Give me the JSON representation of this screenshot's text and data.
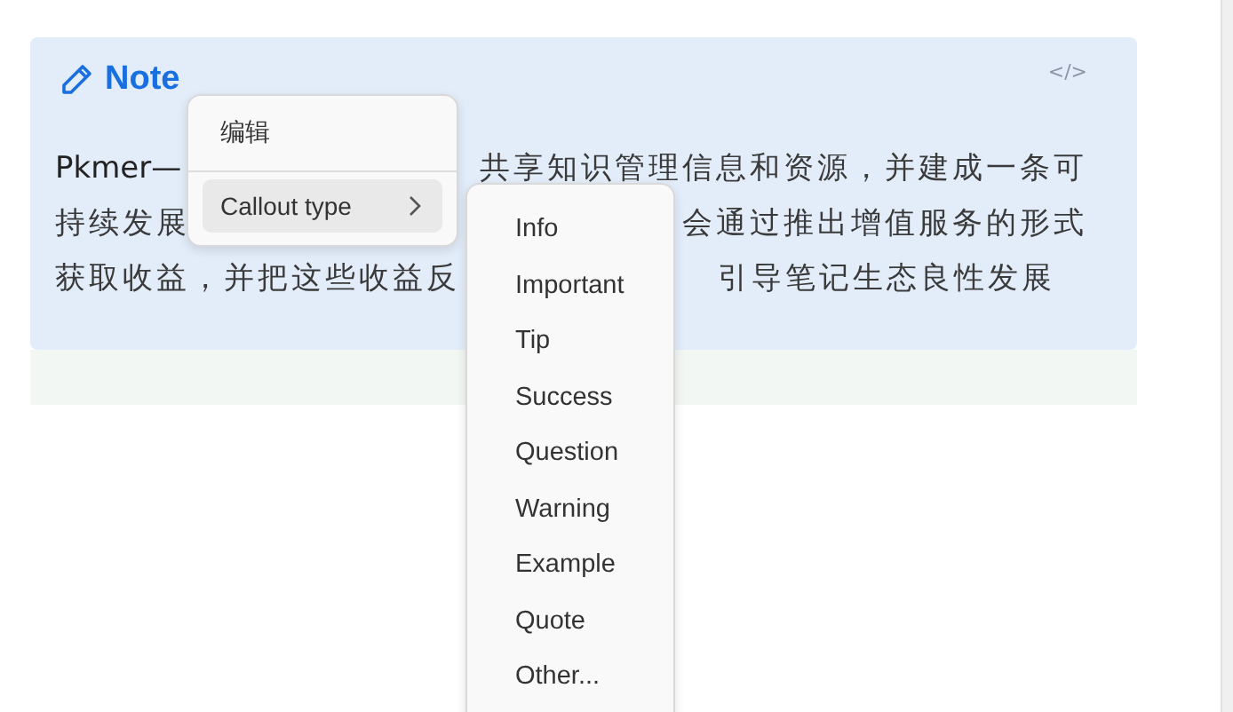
{
  "callout": {
    "title": "Note",
    "code_toggle": "</>",
    "lines": [
      [
        "Pkmer—",
        "共享知识管理信息和资源，并建成一条可"
      ],
      [
        "持续发展",
        "会通过推出增值服务的形式"
      ],
      [
        "获取收益，并把这些收益反",
        "引导笔记生态良性发展"
      ]
    ]
  },
  "context_menu": {
    "items": [
      {
        "label": "编辑",
        "selected": false,
        "has_submenu": false
      },
      {
        "label": "Callout type",
        "selected": true,
        "has_submenu": true
      }
    ]
  },
  "submenu": {
    "items": [
      {
        "label": "Info"
      },
      {
        "label": "Important"
      },
      {
        "label": "Tip"
      },
      {
        "label": "Success"
      },
      {
        "label": "Question"
      },
      {
        "label": "Warning"
      },
      {
        "label": "Example"
      },
      {
        "label": "Quote"
      },
      {
        "label": "Other..."
      }
    ]
  }
}
